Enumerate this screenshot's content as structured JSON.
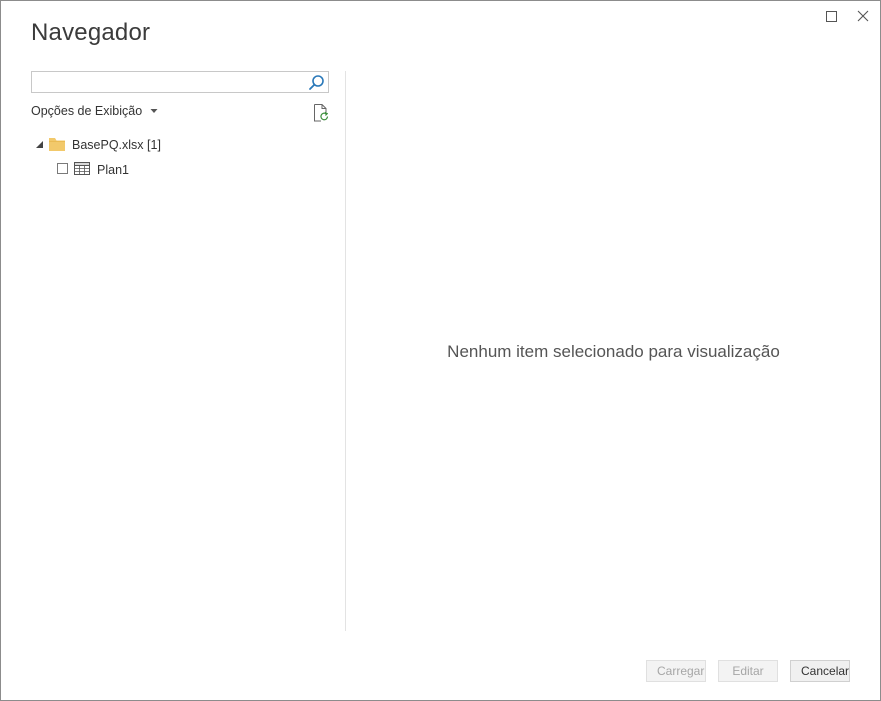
{
  "window": {
    "title": "Navegador",
    "maximize_icon": "maximize-icon",
    "close_icon": "close-icon"
  },
  "search": {
    "value": "",
    "placeholder": "",
    "icon": "search-icon"
  },
  "display_options": {
    "label": "Opções de Exibição",
    "icon": "caret-down-icon"
  },
  "refresh": {
    "icon": "refresh-file-icon"
  },
  "tree": {
    "file": {
      "label": "BasePQ.xlsx [1]",
      "expanded": true,
      "icon": "folder-icon"
    },
    "items": [
      {
        "label": "Plan1",
        "checked": false,
        "icon": "table-icon"
      }
    ]
  },
  "preview": {
    "message": "Nenhum item selecionado para visualização"
  },
  "footer": {
    "load_label": "Carregar",
    "edit_label": "Editar",
    "cancel_label": "Cancelar"
  },
  "colors": {
    "accent": "#2b79b9",
    "folder": "#f2c96b"
  }
}
